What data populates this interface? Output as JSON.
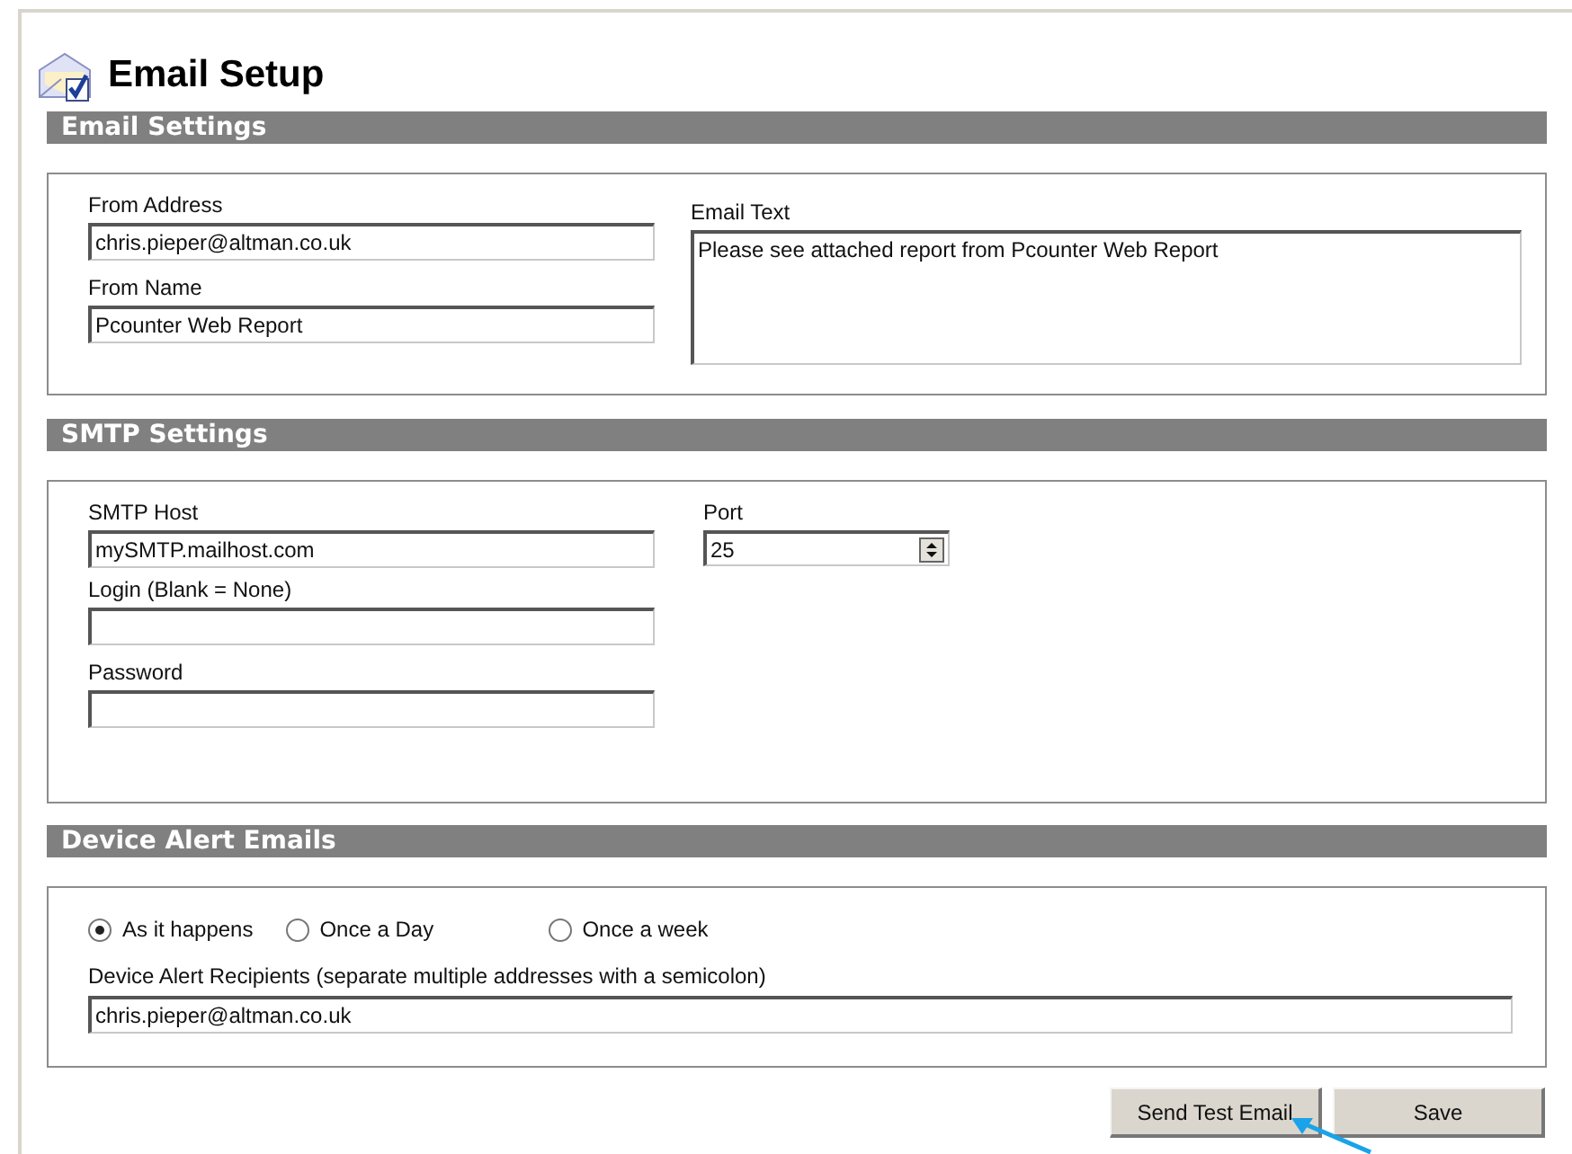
{
  "title": "Email Setup",
  "email_settings": {
    "heading": "Email Settings",
    "from_address": {
      "label": "From Address",
      "value": "chris.pieper@altman.co.uk"
    },
    "from_name": {
      "label": "From Name",
      "value": "Pcounter Web Report"
    },
    "email_text": {
      "label": "Email Text",
      "value": "Please see attached report from Pcounter Web Report"
    }
  },
  "smtp_settings": {
    "heading": "SMTP Settings",
    "host": {
      "label": "SMTP Host",
      "value": "mySMTP.mailhost.com"
    },
    "login": {
      "label": "Login (Blank = None)"
    },
    "password": {
      "label": "Password"
    },
    "port": {
      "label": "Port",
      "value": "25"
    }
  },
  "device_alerts": {
    "heading": "Device Alert Emails",
    "frequency": [
      {
        "label": "As it happens",
        "selected": true
      },
      {
        "label": "Once a Day",
        "selected": false
      },
      {
        "label": "Once a week",
        "selected": false
      }
    ],
    "recipients": {
      "label": "Device Alert Recipients (separate multiple addresses with a semicolon)",
      "value": "chris.pieper@altman.co.uk"
    }
  },
  "buttons": [
    "Send Test Email",
    "Save"
  ]
}
